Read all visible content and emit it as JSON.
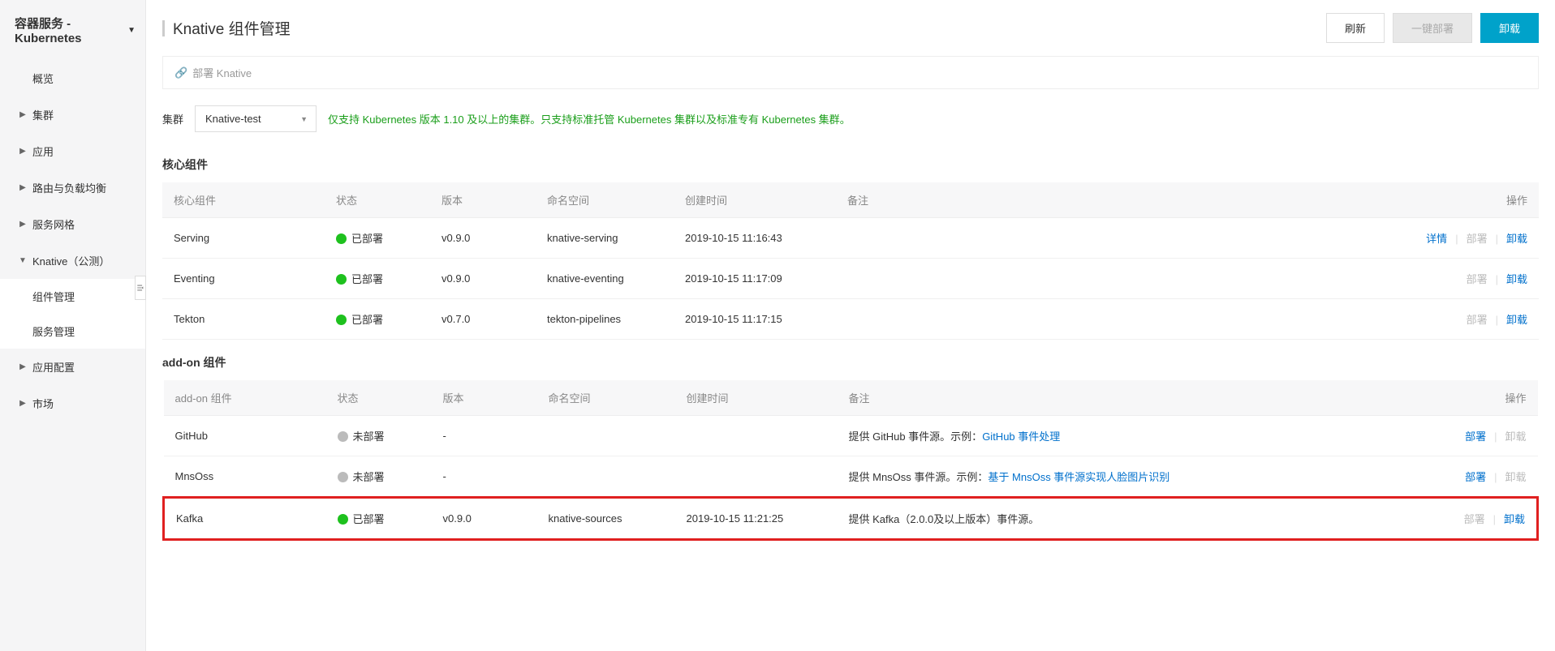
{
  "sidebar": {
    "title": "容器服务 - Kubernetes",
    "items": [
      {
        "label": "概览",
        "caret": "",
        "expanded": false
      },
      {
        "label": "集群",
        "caret": "▶",
        "expanded": false
      },
      {
        "label": "应用",
        "caret": "▶",
        "expanded": false
      },
      {
        "label": "路由与负载均衡",
        "caret": "▶",
        "expanded": false
      },
      {
        "label": "服务网格",
        "caret": "▶",
        "expanded": false
      },
      {
        "label": "Knative（公测）",
        "caret": "▼",
        "expanded": true,
        "subs": [
          {
            "label": "组件管理",
            "active": true
          },
          {
            "label": "服务管理",
            "active": false
          }
        ]
      },
      {
        "label": "应用配置",
        "caret": "▶",
        "expanded": false
      },
      {
        "label": "市场",
        "caret": "▶",
        "expanded": false
      }
    ]
  },
  "header": {
    "title": "Knative 组件管理",
    "refreshLabel": "刷新",
    "deployLabel": "一键部署",
    "uninstallLabel": "卸载"
  },
  "breadcrumb": {
    "text": "部署 Knative"
  },
  "cluster": {
    "label": "集群",
    "selected": "Knative-test",
    "supportText": "仅支持 Kubernetes 版本 1.10 及以上的集群。只支持标准托管 Kubernetes 集群以及标准专有 Kubernetes 集群。"
  },
  "coreSection": {
    "title": "核心组件",
    "columns": {
      "name": "核心组件",
      "status": "状态",
      "version": "版本",
      "namespace": "命名空间",
      "createTime": "创建时间",
      "note": "备注",
      "action": "操作"
    },
    "rows": [
      {
        "name": "Serving",
        "statusDot": "green",
        "statusText": "已部署",
        "version": "v0.9.0",
        "namespace": "knative-serving",
        "createTime": "2019-10-15 11:16:43",
        "note": "",
        "detailLabel": "详情",
        "deployLabel": "部署",
        "uninstallLabel": "卸载",
        "hasDetail": true,
        "deployDisabled": true,
        "uninstallDisabled": false
      },
      {
        "name": "Eventing",
        "statusDot": "green",
        "statusText": "已部署",
        "version": "v0.9.0",
        "namespace": "knative-eventing",
        "createTime": "2019-10-15 11:17:09",
        "note": "",
        "deployLabel": "部署",
        "uninstallLabel": "卸载",
        "hasDetail": false,
        "deployDisabled": true,
        "uninstallDisabled": false
      },
      {
        "name": "Tekton",
        "statusDot": "green",
        "statusText": "已部署",
        "version": "v0.7.0",
        "namespace": "tekton-pipelines",
        "createTime": "2019-10-15 11:17:15",
        "note": "",
        "deployLabel": "部署",
        "uninstallLabel": "卸载",
        "hasDetail": false,
        "deployDisabled": true,
        "uninstallDisabled": false
      }
    ]
  },
  "addonSection": {
    "title": "add-on 组件",
    "columns": {
      "name": "add-on 组件",
      "status": "状态",
      "version": "版本",
      "namespace": "命名空间",
      "createTime": "创建时间",
      "note": "备注",
      "action": "操作"
    },
    "rows": [
      {
        "name": "GitHub",
        "statusDot": "gray",
        "statusText": "未部署",
        "version": "-",
        "namespace": "",
        "createTime": "",
        "notePrefix": "提供 GitHub 事件源。示例：",
        "noteLink": "GitHub 事件处理",
        "noteSuffix": "",
        "deployLabel": "部署",
        "uninstallLabel": "卸载",
        "deployDisabled": false,
        "uninstallDisabled": true,
        "highlight": false
      },
      {
        "name": "MnsOss",
        "statusDot": "gray",
        "statusText": "未部署",
        "version": "-",
        "namespace": "",
        "createTime": "",
        "notePrefix": "提供 MnsOss 事件源。示例：",
        "noteLink": "基于 MnsOss 事件源实现人脸图片识别",
        "noteSuffix": "",
        "deployLabel": "部署",
        "uninstallLabel": "卸载",
        "deployDisabled": false,
        "uninstallDisabled": true,
        "highlight": false
      },
      {
        "name": "Kafka",
        "statusDot": "green",
        "statusText": "已部署",
        "version": "v0.9.0",
        "namespace": "knative-sources",
        "createTime": "2019-10-15 11:21:25",
        "notePrefix": "提供 Kafka（2.0.0及以上版本）事件源。",
        "noteLink": "",
        "noteSuffix": "",
        "deployLabel": "部署",
        "uninstallLabel": "卸载",
        "deployDisabled": true,
        "uninstallDisabled": false,
        "highlight": true
      }
    ]
  }
}
